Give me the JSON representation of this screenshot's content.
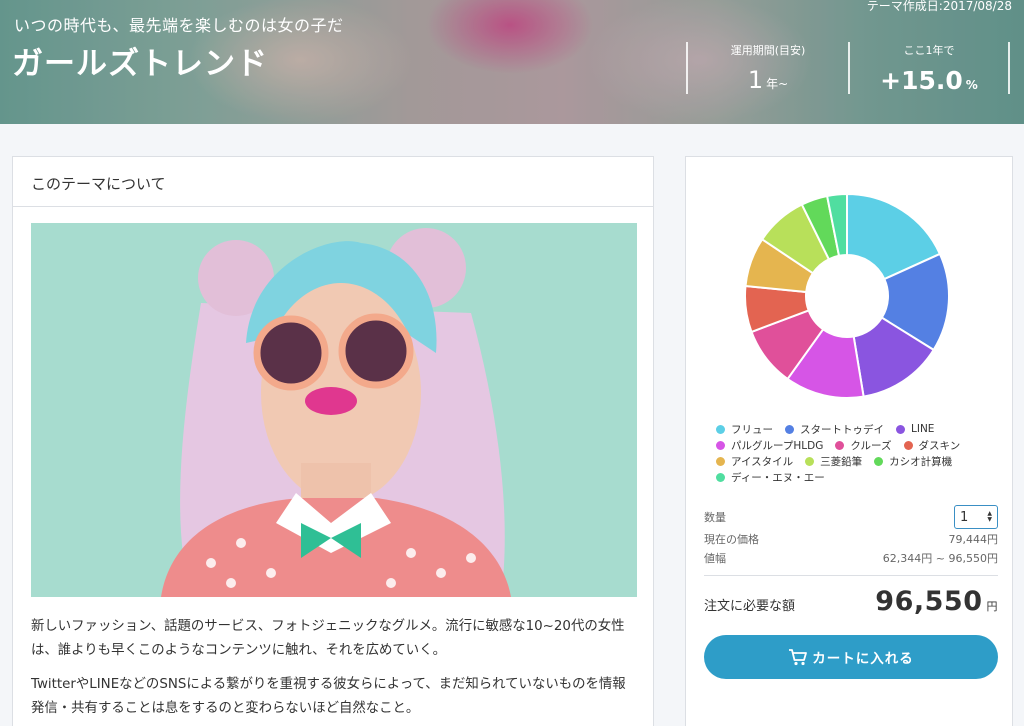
{
  "header": {
    "subtitle": "いつの時代も、最先端を楽しむのは女の子だ",
    "title": "ガールズトレンド",
    "created": "テーマ作成日:2017/08/28",
    "stats": [
      {
        "label": "運用期間(目安)",
        "value": "1",
        "unit": "年~"
      },
      {
        "label": "ここ1年で",
        "value": "+15.0",
        "unit": "%"
      }
    ]
  },
  "about": {
    "heading": "このテーマについて",
    "paragraphs": [
      "新しいファッション、話題のサービス、フォトジェニックなグルメ。流行に敏感な10~20代の女性は、誰よりも早くこのようなコンテンツに触れ、それを広めていく。",
      "TwitterやLINEなどのSNSによる繋がりを重視する彼女らによって、まだ知られていないものを情報発信・共有することは息をするのと変わらないほど自然なこと。"
    ]
  },
  "chart_data": {
    "type": "pie",
    "donut": true,
    "legend_position": "bottom",
    "categories": [
      "フリュー",
      "スタートトゥデイ",
      "LINE",
      "パルグループHLDG",
      "クルーズ",
      "ダスキン",
      "アイスタイル",
      "三菱鉛筆",
      "カシオ計算機",
      "ディー・エヌ・エー"
    ],
    "values": [
      17.5,
      15,
      13,
      12,
      9,
      7,
      7.5,
      8,
      4,
      3
    ],
    "colors": [
      "#5ccfe6",
      "#5480e3",
      "#8a55e0",
      "#d655e6",
      "#e0509a",
      "#e36451",
      "#e5b54f",
      "#b8e05a",
      "#62d95a",
      "#50dea0"
    ]
  },
  "order": {
    "qty_label": "数量",
    "qty_value": "1",
    "price_label": "現在の価格",
    "price_value": "79,444円",
    "range_label": "値幅",
    "range_value": "62,344円 ~ 96,550円",
    "total_label": "注文に必要な額",
    "total_value": "96,550",
    "total_unit": "円",
    "cart_label": "カートに入れる"
  }
}
